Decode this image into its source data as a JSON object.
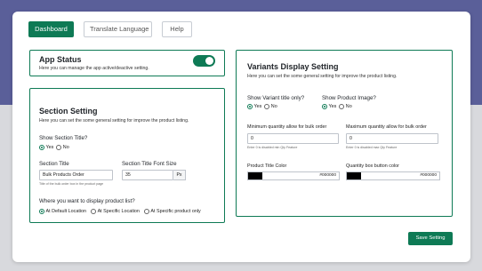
{
  "nav": {
    "dashboard": "Dashboard",
    "translate": "Translate Language",
    "help": "Help"
  },
  "app_status": {
    "title": "App Status",
    "subtitle": "Here you can manage the app active/deactive setting.",
    "enabled": true
  },
  "section_setting": {
    "title": "Section Setting",
    "subtitle": "Here you can set the some general setting for improve the product listing.",
    "show_title_label": "Show Section Title?",
    "yes": "Yes",
    "no": "No",
    "show_title_value": "Yes",
    "title_label": "Section Title",
    "title_value": "Bulk Products Order",
    "title_note": "Title of the bulk order box in the product page",
    "font_size_label": "Section Title Font Size",
    "font_size_value": "35",
    "font_size_unit": "Px",
    "display_label": "Where you want to display product list?",
    "display_options": [
      "At Default Location",
      "At Specific Location",
      "At Specific product only"
    ],
    "display_value": "At Default Location"
  },
  "variants": {
    "title": "Variants Display Setting",
    "subtitle": "Here you can set the some general setting for improve the product listing.",
    "show_variant_title_label": "Show Variant title only?",
    "show_variant_title_value": "Yes",
    "show_product_image_label": "Show Product Image?",
    "show_product_image_value": "Yes",
    "yes": "Yes",
    "no": "No",
    "min_qty_label": "Minimum quantity allow for bulk order",
    "min_qty_value": "0",
    "min_qty_note": "Enter 0 is disabled min Qty Feature",
    "max_qty_label": "Maximum quantity allow for bulk order",
    "max_qty_value": "0",
    "max_qty_note": "Enter 0 is disabled max Qty Feature",
    "product_title_color_label": "Product Title Color",
    "product_title_color_value": "#000000",
    "qty_button_color_label": "Quantity box button color",
    "qty_button_color_value": "#000000"
  },
  "save_label": "Save Setting",
  "colors": {
    "accent": "#0e7a55",
    "header_bg": "#5a5f99",
    "page_bg": "#d8d9dd"
  }
}
